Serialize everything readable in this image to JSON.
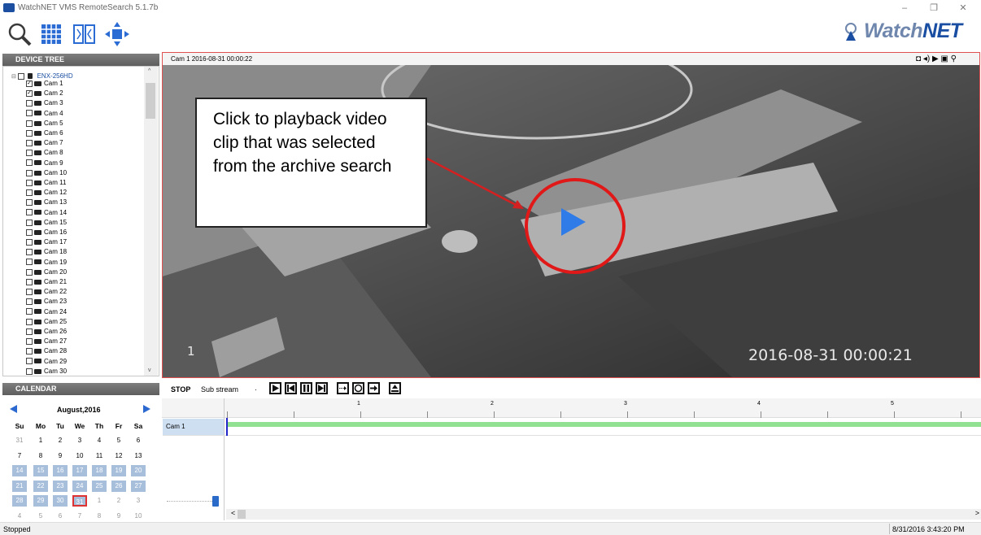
{
  "window": {
    "title": "WatchNET VMS RemoteSearch 5.1.7b",
    "minimize": "–",
    "restore": "❐",
    "close": "✕"
  },
  "logo": {
    "watch": "Watch",
    "net": "NET"
  },
  "toolbar": {
    "icons": [
      "search-icon",
      "grid-icon",
      "split-view-icon",
      "ptz-icon"
    ]
  },
  "device_tree": {
    "header": "DEVICE TREE",
    "root": "ENX-256HD",
    "cams": [
      {
        "label": "Cam 1",
        "checked": true
      },
      {
        "label": "Cam 2",
        "checked": true
      },
      {
        "label": "Cam 3",
        "checked": false
      },
      {
        "label": "Cam 4",
        "checked": false
      },
      {
        "label": "Cam 5",
        "checked": false
      },
      {
        "label": "Cam 6",
        "checked": false
      },
      {
        "label": "Cam 7",
        "checked": false
      },
      {
        "label": "Cam 8",
        "checked": false
      },
      {
        "label": "Cam 9",
        "checked": false
      },
      {
        "label": "Cam 10",
        "checked": false
      },
      {
        "label": "Cam 11",
        "checked": false
      },
      {
        "label": "Cam 12",
        "checked": false
      },
      {
        "label": "Cam 13",
        "checked": false
      },
      {
        "label": "Cam 14",
        "checked": false
      },
      {
        "label": "Cam 15",
        "checked": false
      },
      {
        "label": "Cam 16",
        "checked": false
      },
      {
        "label": "Cam 17",
        "checked": false
      },
      {
        "label": "Cam 18",
        "checked": false
      },
      {
        "label": "Cam 19",
        "checked": false
      },
      {
        "label": "Cam 20",
        "checked": false
      },
      {
        "label": "Cam 21",
        "checked": false
      },
      {
        "label": "Cam 22",
        "checked": false
      },
      {
        "label": "Cam 23",
        "checked": false
      },
      {
        "label": "Cam 24",
        "checked": false
      },
      {
        "label": "Cam 25",
        "checked": false
      },
      {
        "label": "Cam 26",
        "checked": false
      },
      {
        "label": "Cam 27",
        "checked": false
      },
      {
        "label": "Cam 28",
        "checked": false
      },
      {
        "label": "Cam 29",
        "checked": false
      },
      {
        "label": "Cam 30",
        "checked": false
      }
    ]
  },
  "video": {
    "label": "Cam 1  2016-08-31 00:00:22",
    "overlay_timestamp": "2016-08-31 00:00:21",
    "channel": "1",
    "callout": "Click to playback video clip that was selected from the archive search",
    "icons": "◘ ◂) ▶ ▣ ⚲"
  },
  "playback": {
    "stop_label": "STOP",
    "stream": "Sub stream",
    "buttons": [
      "play-icon",
      "skip-start-icon",
      "pause-icon",
      "skip-end-icon",
      "step-forward-icon",
      "record-icon",
      "export-icon",
      "save-icon"
    ]
  },
  "timeline": {
    "ticks": [
      "1",
      "2",
      "3",
      "4",
      "5"
    ],
    "cam_label": "Cam 1"
  },
  "calendar": {
    "header": "CALENDAR",
    "month": "August,2016",
    "dow": [
      "Su",
      "Mo",
      "Tu",
      "We",
      "Th",
      "Fr",
      "Sa"
    ],
    "weeks": [
      [
        "31",
        "1",
        "2",
        "3",
        "4",
        "5",
        "6"
      ],
      [
        "7",
        "8",
        "9",
        "10",
        "11",
        "12",
        "13"
      ],
      [
        "14",
        "15",
        "16",
        "17",
        "18",
        "19",
        "20"
      ],
      [
        "21",
        "22",
        "23",
        "24",
        "25",
        "26",
        "27"
      ],
      [
        "28",
        "29",
        "30",
        "31",
        "1",
        "2",
        "3"
      ],
      [
        "4",
        "5",
        "6",
        "7",
        "8",
        "9",
        "10"
      ]
    ],
    "selected": "31"
  },
  "status": {
    "text": "Stopped",
    "time": "8/31/2016 3:43:20 PM"
  }
}
